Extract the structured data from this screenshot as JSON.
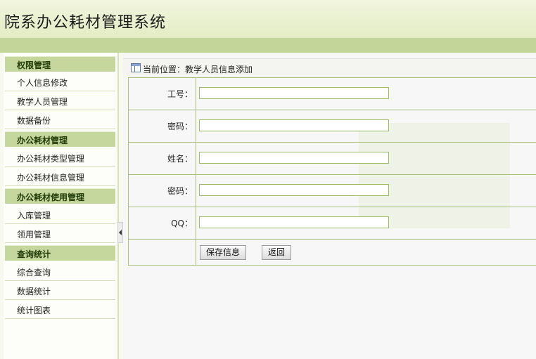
{
  "header": {
    "title": "院系办公耗材管理系统"
  },
  "sidebar": {
    "groups": [
      {
        "title": "权限管理",
        "items": [
          "个人信息修改",
          "教学人员管理",
          "数据备份"
        ]
      },
      {
        "title": "办公耗材管理",
        "items": [
          "办公耗材类型管理",
          "办公耗材信息管理"
        ]
      },
      {
        "title": "办公耗材使用管理",
        "items": [
          "入库管理",
          "领用管理"
        ]
      },
      {
        "title": "查询统计",
        "items": [
          "综合查询",
          "数据统计",
          "统计图表"
        ]
      }
    ]
  },
  "content": {
    "breadcrumb": "当前位置：教学人员信息添加",
    "form": {
      "fields": [
        {
          "label": "工号：",
          "value": ""
        },
        {
          "label": "密码：",
          "value": ""
        },
        {
          "label": "姓名：",
          "value": ""
        },
        {
          "label": "密码：",
          "value": ""
        },
        {
          "label": "QQ：",
          "value": ""
        }
      ],
      "save_label": "保存信息",
      "back_label": "返回"
    }
  }
}
